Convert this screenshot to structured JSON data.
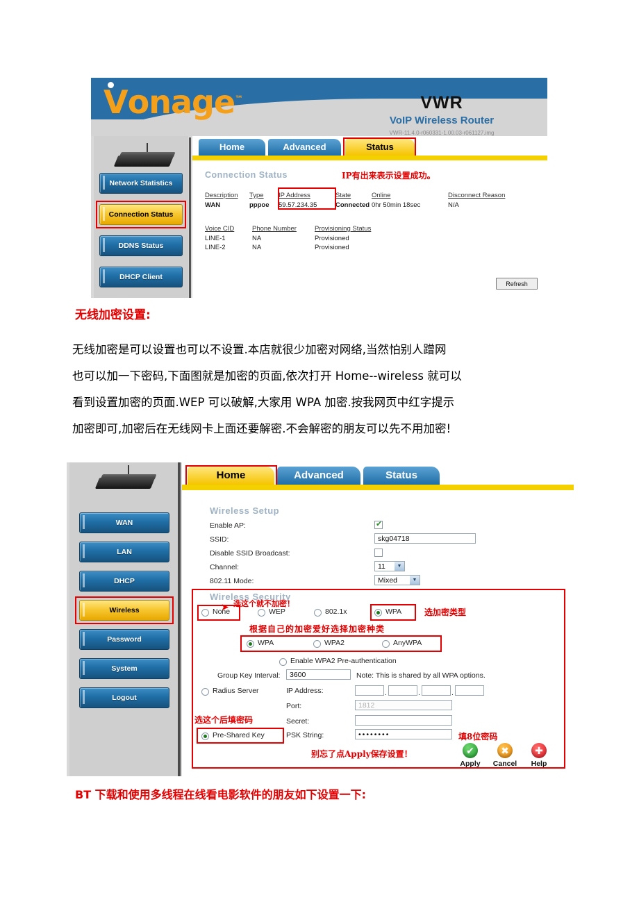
{
  "document": {
    "heading": "无线加密设置:",
    "paragraph_lines": [
      " 无线加密是可以设置也可以不设置.本店就很少加密对网络,当然怕别人蹭网",
      "也可以加一下密码,下面图就是加密的页面,依次打开 Home--wireless 就可以",
      "看到设置加密的页面.WEP 可以破解,大家用 WPA 加密.按我网页中红字提示",
      "加密即可,加密后在无线网卡上面还要解密.不会解密的朋友可以先不用加密!"
    ],
    "footer": "BT 下载和使用多线程在线看电影软件的朋友如下设置一下:"
  },
  "colors": {
    "brand_orange": "#f5a01b",
    "brand_blue": "#2a6ea6",
    "tab_yellow": "#f5d000",
    "annotation_red": "#e40000",
    "panel_gray": "#d9d9d9"
  },
  "status_shot": {
    "logo": "Vonage",
    "logo_tm": "™",
    "model": "VWR",
    "subtitle": "VoIP Wireless Router",
    "firmware": "VWR-11.4.0-r060331-1.00.03-r061127.img",
    "tabs": [
      {
        "label": "Home",
        "state": "inactive"
      },
      {
        "label": "Advanced",
        "state": "inactive"
      },
      {
        "label": "Status",
        "state": "active"
      }
    ],
    "sidebar": [
      {
        "label": "Network Statistics",
        "selected": false
      },
      {
        "label": "Connection Status",
        "selected": true
      },
      {
        "label": "DDNS Status",
        "selected": false
      },
      {
        "label": "DHCP Client",
        "selected": false
      }
    ],
    "section_title": "Connection Status",
    "annotation": "IP有出来表示设置成功。",
    "wan_table": {
      "headers": [
        "Description",
        "Type",
        "IP Address",
        "State",
        "Online",
        "Disconnect Reason"
      ],
      "row": [
        "WAN",
        "pppoe",
        "59.57.234.35",
        "Connected",
        "0hr 50min 18sec",
        "N/A"
      ]
    },
    "voice_table": {
      "headers": [
        "Voice CID",
        "Phone Number",
        "Provisioning Status"
      ],
      "rows": [
        [
          "LINE-1",
          "NA",
          "Provisioned"
        ],
        [
          "LINE-2",
          "NA",
          "Provisioned"
        ]
      ]
    },
    "refresh_label": "Refresh"
  },
  "wireless_shot": {
    "tabs": [
      {
        "label": "Home",
        "state": "active"
      },
      {
        "label": "Advanced",
        "state": "inactive"
      },
      {
        "label": "Status",
        "state": "inactive"
      }
    ],
    "sidebar": [
      {
        "label": "WAN",
        "selected": false
      },
      {
        "label": "LAN",
        "selected": false
      },
      {
        "label": "DHCP",
        "selected": false
      },
      {
        "label": "Wireless",
        "selected": true
      },
      {
        "label": "Password",
        "selected": false
      },
      {
        "label": "System",
        "selected": false
      },
      {
        "label": "Logout",
        "selected": false
      }
    ],
    "setup": {
      "title": "Wireless Setup",
      "enable_ap_label": "Enable AP:",
      "enable_ap_checked": true,
      "ssid_label": "SSID:",
      "ssid_value": "skg04718",
      "disable_broadcast_label": "Disable SSID Broadcast:",
      "disable_broadcast_checked": false,
      "channel_label": "Channel:",
      "channel_value": "11",
      "mode_label": "802.11 Mode:",
      "mode_value": "Mixed"
    },
    "security": {
      "title": "Wireless Security",
      "mode_options": [
        {
          "label": "None",
          "selected": false
        },
        {
          "label": "WEP",
          "selected": false
        },
        {
          "label": "802.1x",
          "selected": false
        },
        {
          "label": "WPA",
          "selected": true
        }
      ],
      "wpa_options": [
        {
          "label": "WPA",
          "selected": true
        },
        {
          "label": "WPA2",
          "selected": false
        },
        {
          "label": "AnyWPA",
          "selected": false
        }
      ],
      "preauth_label": "Enable WPA2 Pre-authentication",
      "preauth_selected": false,
      "group_key_label": "Group Key Interval:",
      "group_key_value": "3600",
      "group_key_note": "Note: This is shared by all WPA options.",
      "radius_label": "Radius Server",
      "radius_selected": false,
      "ip_label": "IP Address:",
      "ip_octets": [
        "",
        "",
        "",
        ""
      ],
      "port_label": "Port:",
      "port_value": "1812",
      "secret_label": "Secret:",
      "secret_value": "",
      "psk_label": "Pre-Shared Key",
      "psk_selected": true,
      "psk_string_label": "PSK String:",
      "psk_string_value": "••••••••"
    },
    "annotations": {
      "none_hint": "选这个就不加密！",
      "type_hint": "选加密类型",
      "kind_hint": "根据自己的加密爱好选择加密种类",
      "psk_hint": "选这个后填密码",
      "pwd_hint": "填8位密码",
      "apply_hint": "别忘了点Apply保存设置！"
    },
    "actions": [
      {
        "label": "Apply",
        "icon": "check-circle-icon",
        "color": "#1f9e2f"
      },
      {
        "label": "Cancel",
        "icon": "x-circle-icon",
        "color": "#e8880c"
      },
      {
        "label": "Help",
        "icon": "plus-circle-icon",
        "color": "#e01b24"
      }
    ]
  }
}
